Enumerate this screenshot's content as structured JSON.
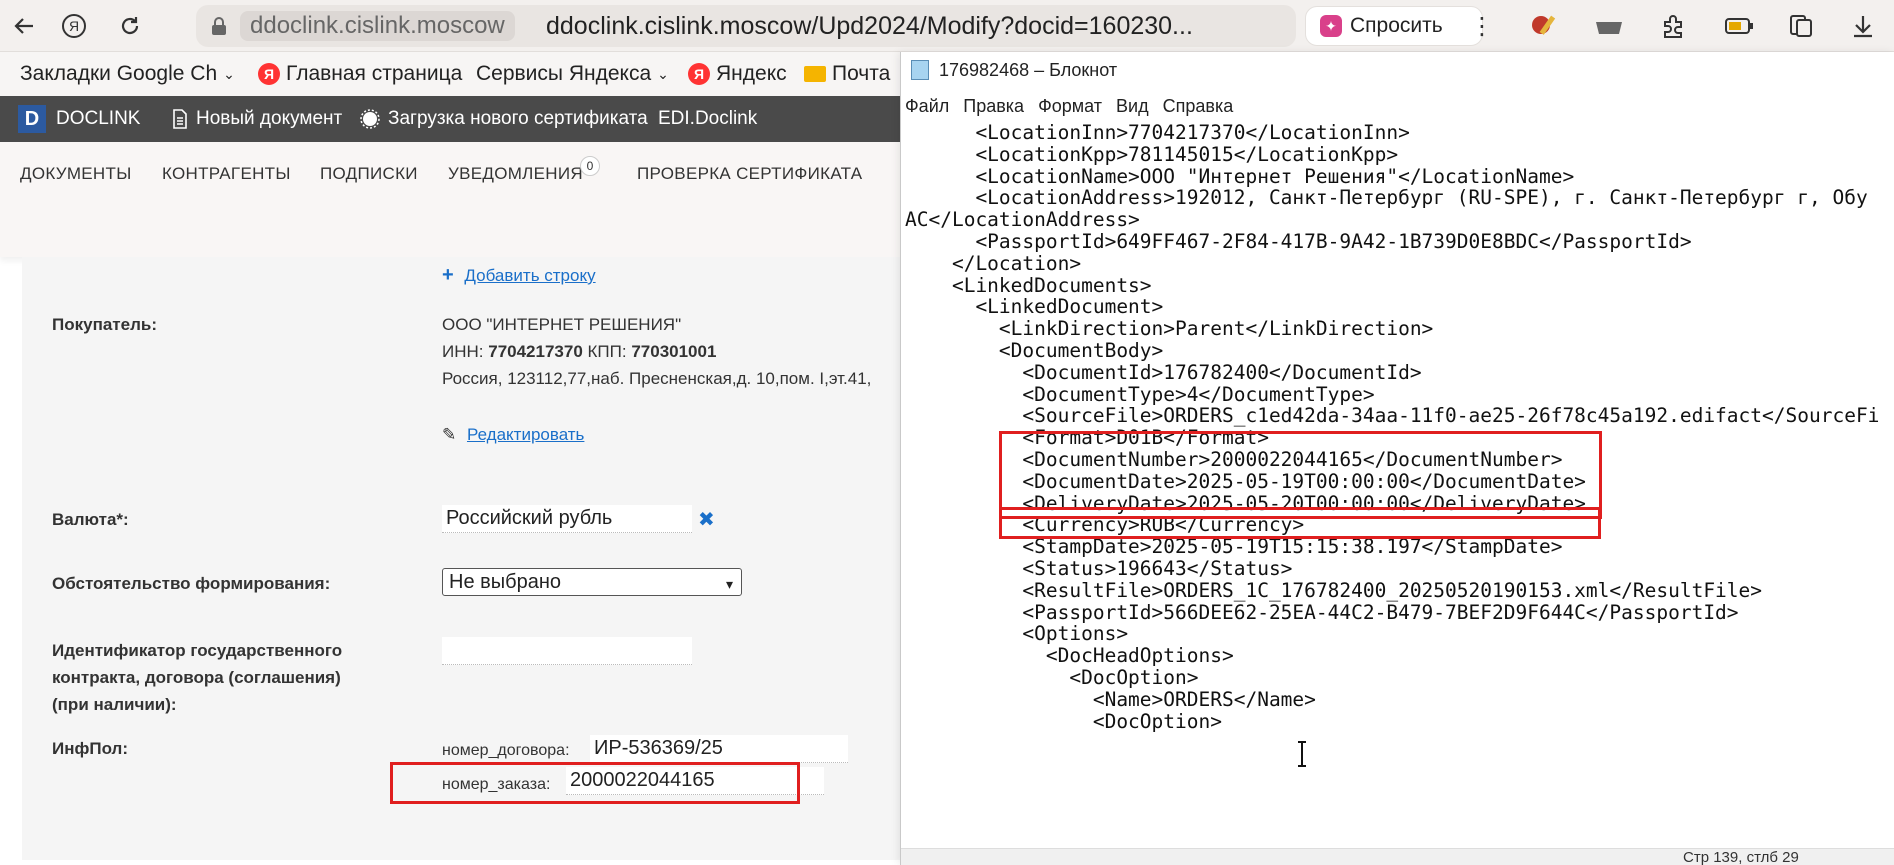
{
  "browser": {
    "host_chip": "ddoclink.cislink.moscow",
    "url": "ddoclink.cislink.moscow/Upd2024/Modify?docid=160230...",
    "ask_label": "Спросить"
  },
  "bookmarks": [
    {
      "label": "Закладки Google Ch"
    },
    {
      "label": "Главная страница"
    },
    {
      "label": "Сервисы Яндекса"
    },
    {
      "label": "Яндекс"
    },
    {
      "label": "Почта"
    }
  ],
  "app": {
    "logo_letter": "D",
    "brand": "DOCLINK",
    "new_doc": "Новый документ",
    "upload_cert": "Загрузка нового сертификата",
    "edi": "EDI.Doclink",
    "nav": [
      "ДОКУМЕНТЫ",
      "КОНТРАГЕНТЫ",
      "ПОДПИСКИ",
      "УВЕДОМЛЕНИЯ",
      "ПРОВЕРКА СЕРТИФИКАТА"
    ],
    "notif_count": "0"
  },
  "form": {
    "add_row": "Добавить строку",
    "buyer_label": "Покупатель:",
    "buyer_name": "ООО \"ИНТЕРНЕТ РЕШЕНИЯ\"",
    "inn_label": "ИНН:",
    "inn_value": "7704217370",
    "kpp_label": "КПП:",
    "kpp_value": "770301001",
    "address": "Россия, 123112,77,наб. Пресненская,д. 10,пом. I,эт.41,",
    "edit_link": "Редактировать",
    "currency_label": "Валюта*:",
    "currency_value": "Российский рубль",
    "circumstance_label": "Обстоятельство формирования:",
    "circumstance_value": "Не выбрано",
    "gov_id_label_1": "Идентификатор государственного",
    "gov_id_label_2": "контракта, договора (соглашения)",
    "gov_id_label_3": "(при наличии):",
    "gov_id_value": "",
    "infpol_label": "ИнфПол:",
    "contract_key": "номер_договора:",
    "contract_value": "ИР-536369/25",
    "order_key": "номер_заказа:",
    "order_value": "2000022044165"
  },
  "notepad": {
    "title": "176982468 – Блокнот",
    "menu": [
      "Файл",
      "Правка",
      "Формат",
      "Вид",
      "Справка"
    ],
    "lines": [
      "      <LocationInn>7704217370</LocationInn>",
      "      <LocationKpp>781145015</LocationKpp>",
      "      <LocationName>ООО \"Интернет Решения\"</LocationName>",
      "      <LocationAddress>192012, Санкт-Петербург (RU-SPE), г. Санкт-Петербург г, Обу",
      "АС</LocationAddress>",
      "      <PassportId>649FF467-2F84-417B-9A42-1B739D0E8BDC</PassportId>",
      "    </Location>",
      "    <LinkedDocuments>",
      "      <LinkedDocument>",
      "        <LinkDirection>Parent</LinkDirection>",
      "        <DocumentBody>",
      "          <DocumentId>176782400</DocumentId>",
      "          <DocumentType>4</DocumentType>",
      "          <SourceFile>ORDERS_c1ed42da-34aa-11f0-ae25-26f78c45a192.edifact</SourceFi",
      "          <Format>D01B</Format>",
      "          <DocumentNumber>2000022044165</DocumentNumber>",
      "          <DocumentDate>2025-05-19T00:00:00</DocumentDate>",
      "          <DeliveryDate>2025-05-20T00:00:00</DeliveryDate>",
      "          <Currency>RUB</Currency>",
      "          <StampDate>2025-05-19T15:15:38.197</StampDate>",
      "          <Status>196643</Status>",
      "          <ResultFile>ORDERS_1C_176782400_20250520190153.xml</ResultFile>",
      "          <PassportId>566DEE62-25EA-44C2-B479-7BEF2D9F644C</PassportId>",
      "          <Options>",
      "            <DocHeadOptions>",
      "              <DocOption>",
      "                <Name>ORDERS</Name>",
      "                <DocOption>"
    ],
    "status": "Стр 139, стлб 29"
  },
  "colors": {
    "highlight": "#e01f1f",
    "link": "#1a6fc9",
    "appbar": "#4a4a4a"
  }
}
